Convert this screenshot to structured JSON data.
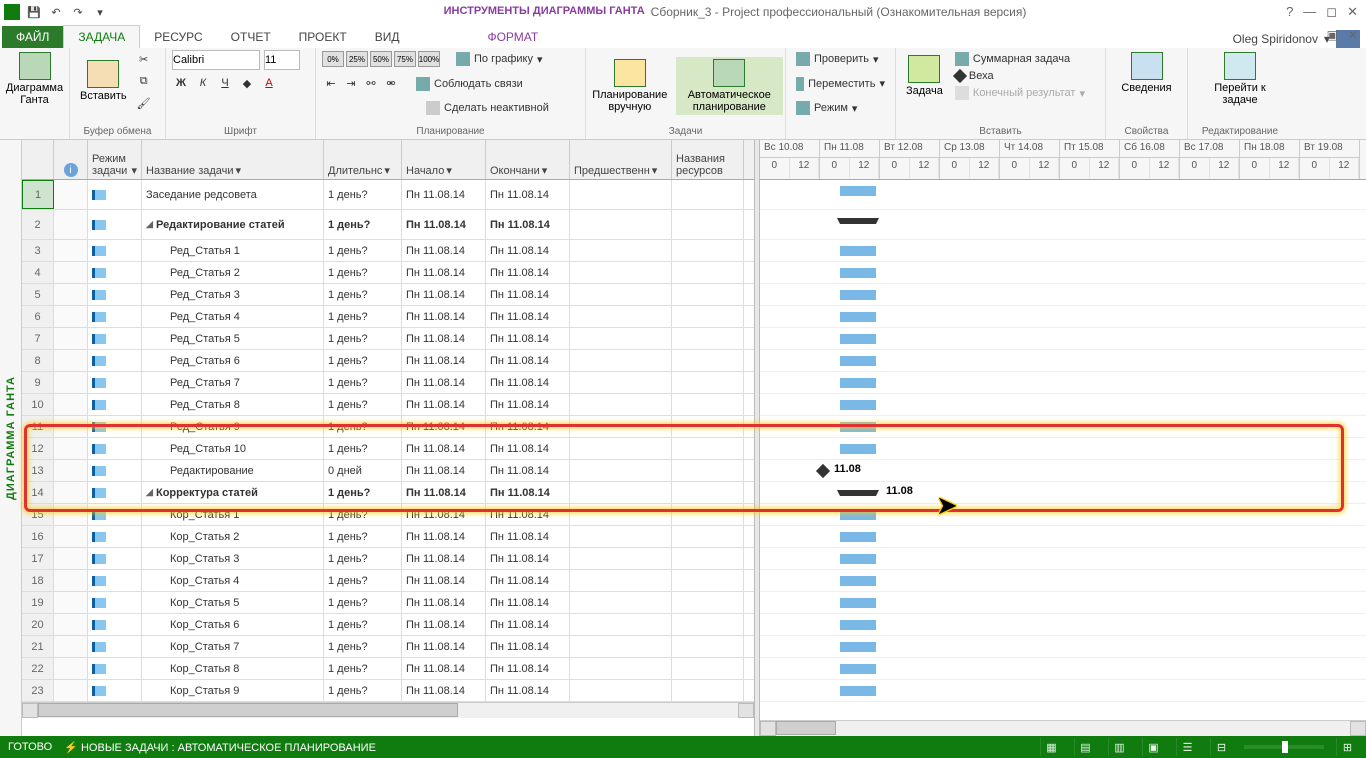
{
  "title": {
    "tool_context": "ИНСТРУМЕНТЫ ДИАГРАММЫ ГАНТА",
    "doc": "Сборник_3 - Project профессиональный (Ознакомительная версия)"
  },
  "tabs": {
    "file": "ФАЙЛ",
    "task": "ЗАДАЧА",
    "resource": "РЕСУРС",
    "report": "ОТЧЕТ",
    "project": "ПРОЕКТ",
    "view": "ВИД",
    "format": "ФОРМАТ"
  },
  "user": "Oleg Spiridonov",
  "ribbon": {
    "gantt_btn": "Диаграмма Ганта",
    "paste_btn": "Вставить",
    "clipboard_label": "Буфер обмена",
    "font_name": "Calibri",
    "font_size": "11",
    "font_label": "Шрифт",
    "pct_labels": [
      "0%",
      "25%",
      "50%",
      "75%",
      "100%"
    ],
    "plan_label": "Планирование",
    "link_schedule": "По графику",
    "link_respect": "Соблюдать связи",
    "link_inactive": "Сделать неактивной",
    "manual": "Планирование вручную",
    "auto": "Автоматическое планирование",
    "tasks_label": "Задачи",
    "check": "Проверить",
    "move": "Переместить",
    "mode": "Режим",
    "task_btn": "Задача",
    "summary_task": "Суммарная задача",
    "milestone": "Веха",
    "deliverable": "Конечный результат",
    "insert_label": "Вставить",
    "info_btn": "Сведения",
    "props_label": "Свойства",
    "goto_btn": "Перейти к задаче",
    "edit_label": "Редактирование"
  },
  "side_label": "ДИАГРАММА ГАНТА",
  "columns": {
    "info": "ⓘ",
    "mode": "Режим задачи",
    "name": "Название задачи",
    "duration": "Длительнс",
    "start": "Начало",
    "finish": "Окончани",
    "pred": "Предшественн",
    "res": "Названия ресурсов"
  },
  "days": [
    "Вс 10.08",
    "Пн 11.08",
    "Вт 12.08",
    "Ср 13.08",
    "Чт 14.08",
    "Пт 15.08",
    "Сб 16.08",
    "Вс 17.08",
    "Пн 18.08",
    "Вт 19.08"
  ],
  "hours": [
    "0",
    "12"
  ],
  "rows": [
    {
      "n": 1,
      "name": "Заседание редсовета",
      "dur": "1 день?",
      "start": "Пн 11.08.14",
      "end": "Пн 11.08.14",
      "indent": 0,
      "type": "task"
    },
    {
      "n": 2,
      "name": "Редактирование статей",
      "dur": "1 день?",
      "start": "Пн 11.08.14",
      "end": "Пн 11.08.14",
      "indent": 0,
      "type": "summary"
    },
    {
      "n": 3,
      "name": "Ред_Статья 1",
      "dur": "1 день?",
      "start": "Пн 11.08.14",
      "end": "Пн 11.08.14",
      "indent": 2,
      "type": "task"
    },
    {
      "n": 4,
      "name": "Ред_Статья 2",
      "dur": "1 день?",
      "start": "Пн 11.08.14",
      "end": "Пн 11.08.14",
      "indent": 2,
      "type": "task"
    },
    {
      "n": 5,
      "name": "Ред_Статья 3",
      "dur": "1 день?",
      "start": "Пн 11.08.14",
      "end": "Пн 11.08.14",
      "indent": 2,
      "type": "task"
    },
    {
      "n": 6,
      "name": "Ред_Статья 4",
      "dur": "1 день?",
      "start": "Пн 11.08.14",
      "end": "Пн 11.08.14",
      "indent": 2,
      "type": "task"
    },
    {
      "n": 7,
      "name": "Ред_Статья 5",
      "dur": "1 день?",
      "start": "Пн 11.08.14",
      "end": "Пн 11.08.14",
      "indent": 2,
      "type": "task"
    },
    {
      "n": 8,
      "name": "Ред_Статья 6",
      "dur": "1 день?",
      "start": "Пн 11.08.14",
      "end": "Пн 11.08.14",
      "indent": 2,
      "type": "task"
    },
    {
      "n": 9,
      "name": "Ред_Статья 7",
      "dur": "1 день?",
      "start": "Пн 11.08.14",
      "end": "Пн 11.08.14",
      "indent": 2,
      "type": "task"
    },
    {
      "n": 10,
      "name": "Ред_Статья 8",
      "dur": "1 день?",
      "start": "Пн 11.08.14",
      "end": "Пн 11.08.14",
      "indent": 2,
      "type": "task"
    },
    {
      "n": 11,
      "name": "Ред_Статья 9",
      "dur": "1 день?",
      "start": "Пн 11.08.14",
      "end": "Пн 11.08.14",
      "indent": 2,
      "type": "task"
    },
    {
      "n": 12,
      "name": "Ред_Статья 10",
      "dur": "1 день?",
      "start": "Пн 11.08.14",
      "end": "Пн 11.08.14",
      "indent": 2,
      "type": "task"
    },
    {
      "n": 13,
      "name": "Редактирование",
      "dur": "0 дней",
      "start": "Пн 11.08.14",
      "end": "Пн 11.08.14",
      "indent": 2,
      "type": "milestone",
      "label": "11.08"
    },
    {
      "n": 14,
      "name": "Корректура статей",
      "dur": "1 день?",
      "start": "Пн 11.08.14",
      "end": "Пн 11.08.14",
      "indent": 0,
      "type": "summary",
      "label": "11.08"
    },
    {
      "n": 15,
      "name": "Кор_Статья 1",
      "dur": "1 день?",
      "start": "Пн 11.08.14",
      "end": "Пн 11.08.14",
      "indent": 2,
      "type": "task"
    },
    {
      "n": 16,
      "name": "Кор_Статья 2",
      "dur": "1 день?",
      "start": "Пн 11.08.14",
      "end": "Пн 11.08.14",
      "indent": 2,
      "type": "task"
    },
    {
      "n": 17,
      "name": "Кор_Статья 3",
      "dur": "1 день?",
      "start": "Пн 11.08.14",
      "end": "Пн 11.08.14",
      "indent": 2,
      "type": "task"
    },
    {
      "n": 18,
      "name": "Кор_Статья 4",
      "dur": "1 день?",
      "start": "Пн 11.08.14",
      "end": "Пн 11.08.14",
      "indent": 2,
      "type": "task"
    },
    {
      "n": 19,
      "name": "Кор_Статья 5",
      "dur": "1 день?",
      "start": "Пн 11.08.14",
      "end": "Пн 11.08.14",
      "indent": 2,
      "type": "task"
    },
    {
      "n": 20,
      "name": "Кор_Статья 6",
      "dur": "1 день?",
      "start": "Пн 11.08.14",
      "end": "Пн 11.08.14",
      "indent": 2,
      "type": "task"
    },
    {
      "n": 21,
      "name": "Кор_Статья 7",
      "dur": "1 день?",
      "start": "Пн 11.08.14",
      "end": "Пн 11.08.14",
      "indent": 2,
      "type": "task"
    },
    {
      "n": 22,
      "name": "Кор_Статья 8",
      "dur": "1 день?",
      "start": "Пн 11.08.14",
      "end": "Пн 11.08.14",
      "indent": 2,
      "type": "task"
    },
    {
      "n": 23,
      "name": "Кор_Статья 9",
      "dur": "1 день?",
      "start": "Пн 11.08.14",
      "end": "Пн 11.08.14",
      "indent": 2,
      "type": "task"
    }
  ],
  "status": {
    "ready": "ГОТОВО",
    "new_tasks": "НОВЫЕ ЗАДАЧИ : АВТОМАТИЧЕСКОЕ ПЛАНИРОВАНИЕ"
  }
}
